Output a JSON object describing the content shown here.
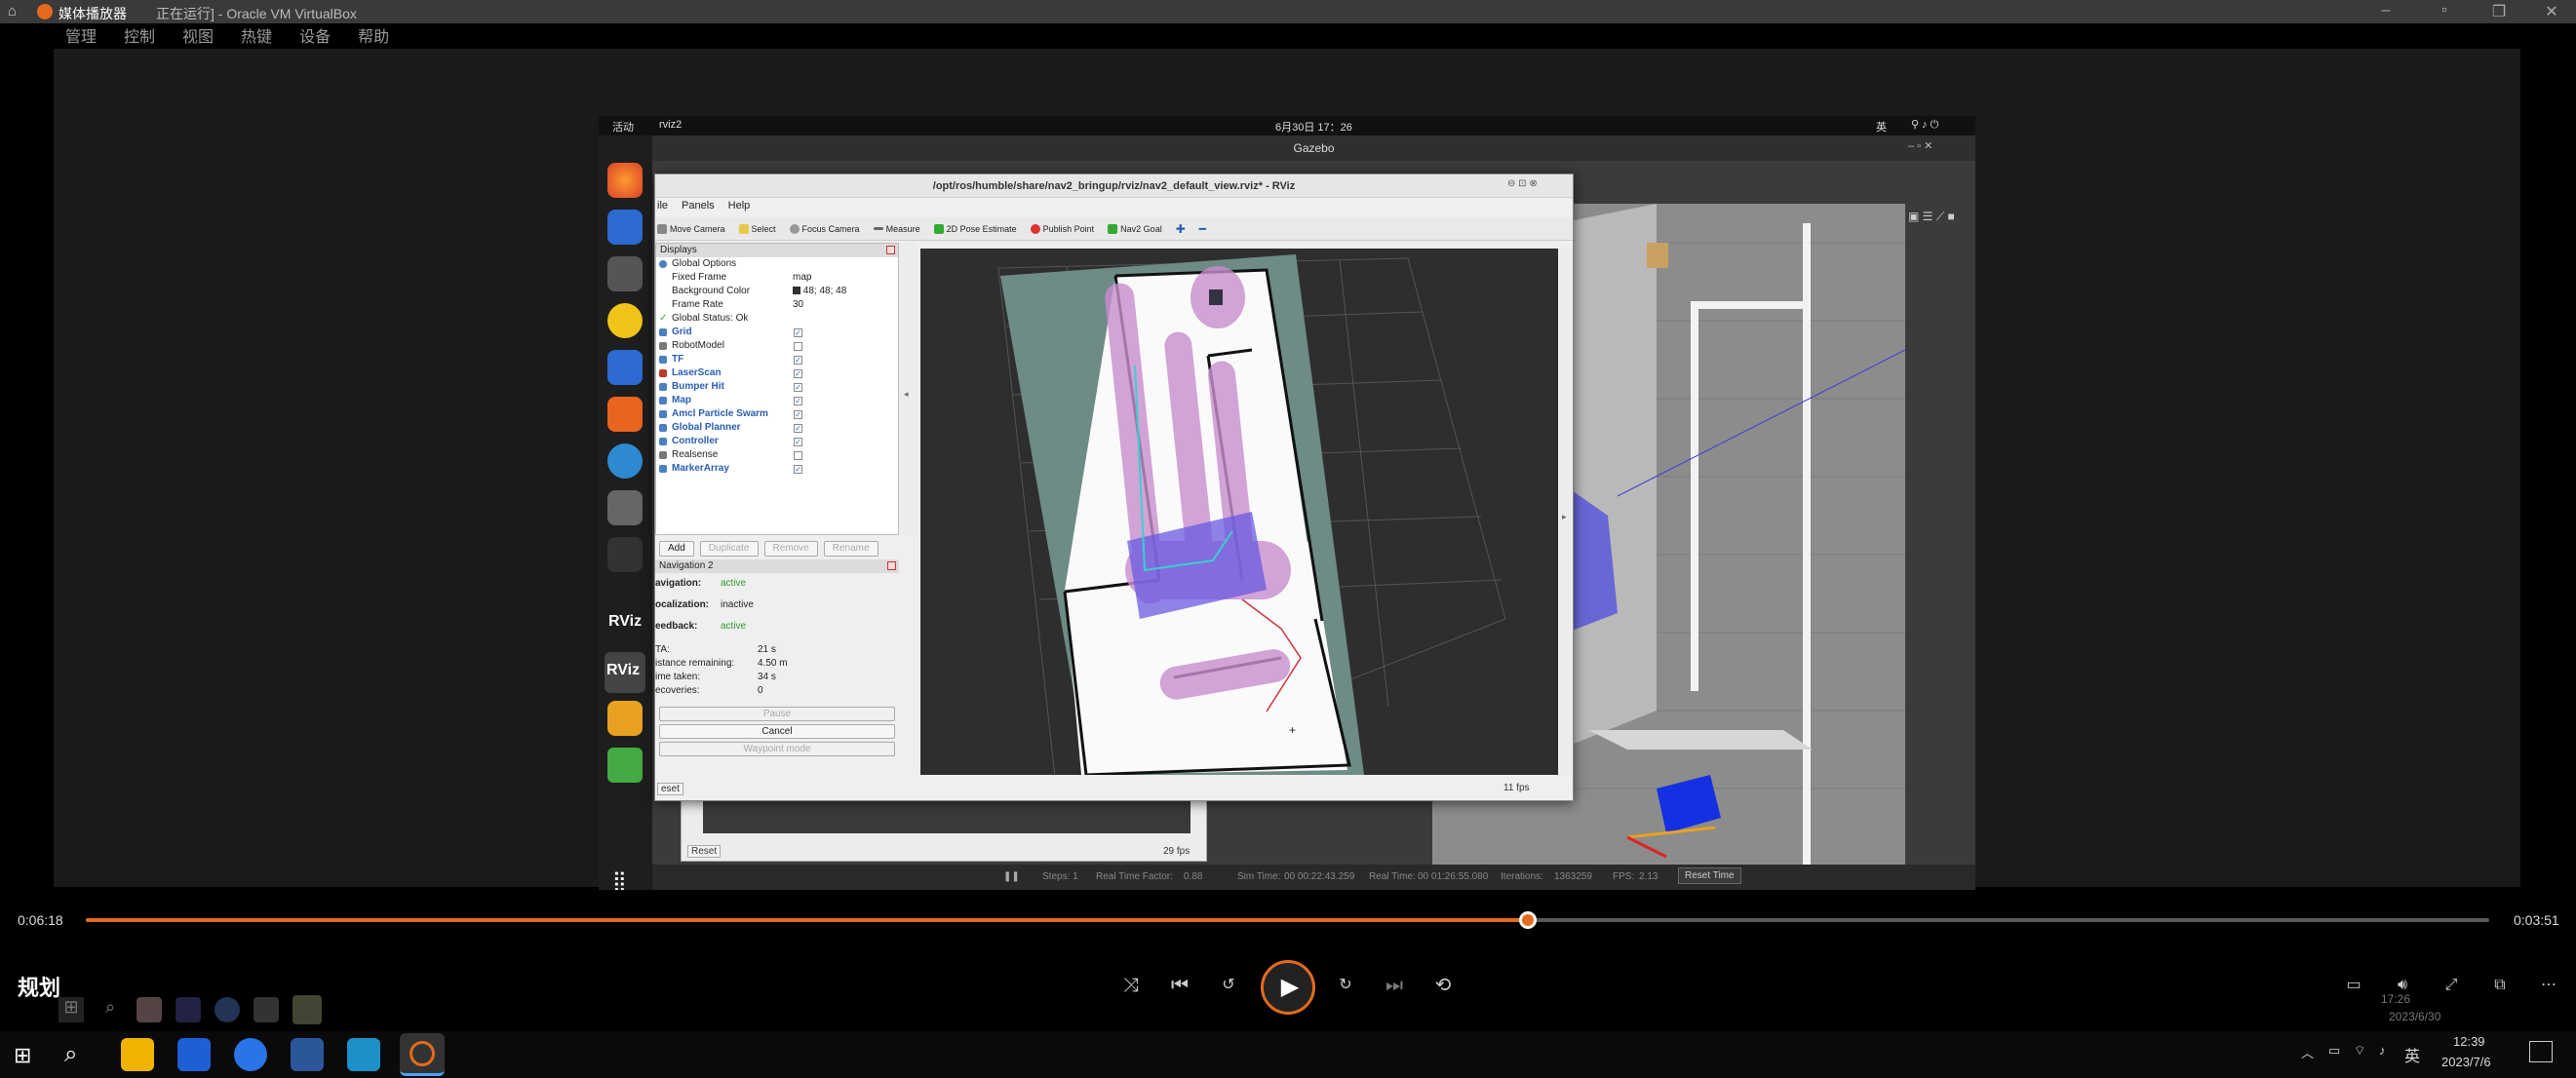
{
  "host": {
    "window_title": "正在运行] - Oracle VM VirtualBox",
    "player_title": "媒体播放器",
    "menu": [
      "管理",
      "控制",
      "视图",
      "热键",
      "设备",
      "帮助"
    ]
  },
  "guest": {
    "topbar": {
      "activities": "活动",
      "app": "rviz2",
      "clock": "6月30日 17：26",
      "lang": "英"
    },
    "gazebo_title": "Gazebo",
    "gazebo_status": {
      "steps": "Steps: 1",
      "real_time_factor_label": "Real Time Factor:",
      "real_time_factor": "0.88",
      "sim_time_label": "Sim Time:",
      "sim_time": "00 00:22:43.259",
      "real_time_label": "Real Time:",
      "real_time": "00 01:26:55.080",
      "iterations_label": "Iterations:",
      "iterations": "1363259",
      "fps_label": "FPS:",
      "fps": "2.13",
      "reset_time": "Reset Time"
    },
    "underlying_window": {
      "reset": "Reset",
      "fps": "29 fps"
    }
  },
  "rviz": {
    "title": "/opt/ros/humble/share/nav2_bringup/rviz/nav2_default_view.rviz* - RViz",
    "menu": [
      "ile",
      "Panels",
      "Help"
    ],
    "tools": [
      "Move Camera",
      "Select",
      "Focus Camera",
      "Measure",
      "2D Pose Estimate",
      "Publish Point",
      "Nav2 Goal"
    ],
    "displays": {
      "header": "Displays",
      "global_options": "Global Options",
      "fixed_frame_label": "Fixed Frame",
      "fixed_frame": "map",
      "bg_label": "Background Color",
      "bg_value": "48; 48; 48",
      "frame_rate_label": "Frame Rate",
      "frame_rate": "30",
      "global_status": "Global Status: Ok",
      "items": [
        {
          "label": "Grid",
          "checked": true,
          "color": "#4a7fc1"
        },
        {
          "label": "RobotModel",
          "checked": false,
          "color": "#777777"
        },
        {
          "label": "TF",
          "checked": true,
          "color": "#4a7fc1"
        },
        {
          "label": "LaserScan",
          "checked": true,
          "color": "#c0392b"
        },
        {
          "label": "Bumper Hit",
          "checked": true,
          "color": "#4a7fc1"
        },
        {
          "label": "Map",
          "checked": true,
          "color": "#4a7fc1"
        },
        {
          "label": "Amcl Particle Swarm",
          "checked": true,
          "color": "#4a7fc1"
        },
        {
          "label": "Global Planner",
          "checked": true,
          "color": "#4a7fc1"
        },
        {
          "label": "Controller",
          "checked": true,
          "color": "#4a7fc1"
        },
        {
          "label": "Realsense",
          "checked": false,
          "color": "#777777"
        },
        {
          "label": "MarkerArray",
          "checked": true,
          "color": "#4a7fc1"
        }
      ],
      "buttons": [
        "Add",
        "Duplicate",
        "Remove",
        "Rename"
      ]
    },
    "nav2": {
      "header": "Navigation 2",
      "navigation_label": "avigation:",
      "navigation": "active",
      "localization_label": "ocalization:",
      "localization": "inactive",
      "feedback_label": "eedback:",
      "feedback": "active",
      "eta_label": "TA:",
      "eta": "21 s",
      "dist_label": "istance remaining:",
      "dist": "4.50 m",
      "time_label": "ime taken:",
      "time": "34 s",
      "rec_label": "ecoveries:",
      "rec": "0",
      "pause": "Pause",
      "cancel": "Cancel",
      "waypoint": "Waypoint mode"
    },
    "fps": "11 fps",
    "reset": "eset"
  },
  "player": {
    "elapsed": "0:06:18",
    "total": "0:03:51",
    "progress": 0.6,
    "title": "规划",
    "accent": "#e56a1e"
  },
  "taskbar": {
    "time": "12:39",
    "date": "2023/7/6",
    "guest_time": "17:26",
    "guest_date": "2023/6/30",
    "lang": "英"
  }
}
